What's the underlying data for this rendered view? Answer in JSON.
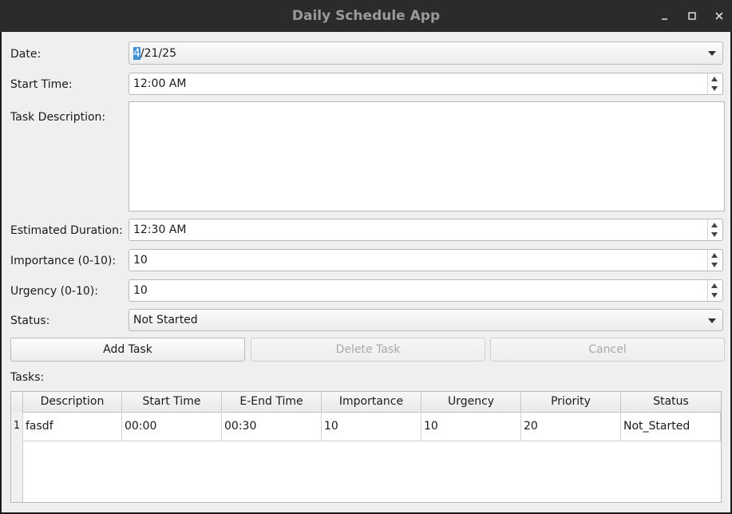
{
  "window": {
    "title": "Daily Schedule App"
  },
  "form": {
    "date_label": "Date:",
    "date_value_selected": "4",
    "date_value_rest": "/21/25",
    "start_time_label": "Start Time:",
    "start_time_value": "12:00 AM",
    "description_label": "Task Description:",
    "description_value": "",
    "duration_label": "Estimated Duration:",
    "duration_value": "12:30 AM",
    "importance_label": "Importance (0-10):",
    "importance_value": "10",
    "urgency_label": "Urgency (0-10):",
    "urgency_value": "10",
    "status_label": "Status:",
    "status_value": "Not Started"
  },
  "buttons": {
    "add": "Add Task",
    "delete": "Delete Task",
    "cancel": "Cancel"
  },
  "tasks": {
    "label": "Tasks:",
    "columns": [
      "Description",
      "Start Time",
      "E-End Time",
      "Importance",
      "Urgency",
      "Priority",
      "Status"
    ],
    "rows": [
      {
        "num": "1",
        "cells": [
          "fasdf",
          "00:00",
          "00:30",
          "10",
          "10",
          "20",
          "Not_Started"
        ]
      }
    ]
  },
  "colors": {
    "selection": "#3b8fd4",
    "titlebar": "#2b2b2b",
    "window_bg": "#efefef"
  }
}
